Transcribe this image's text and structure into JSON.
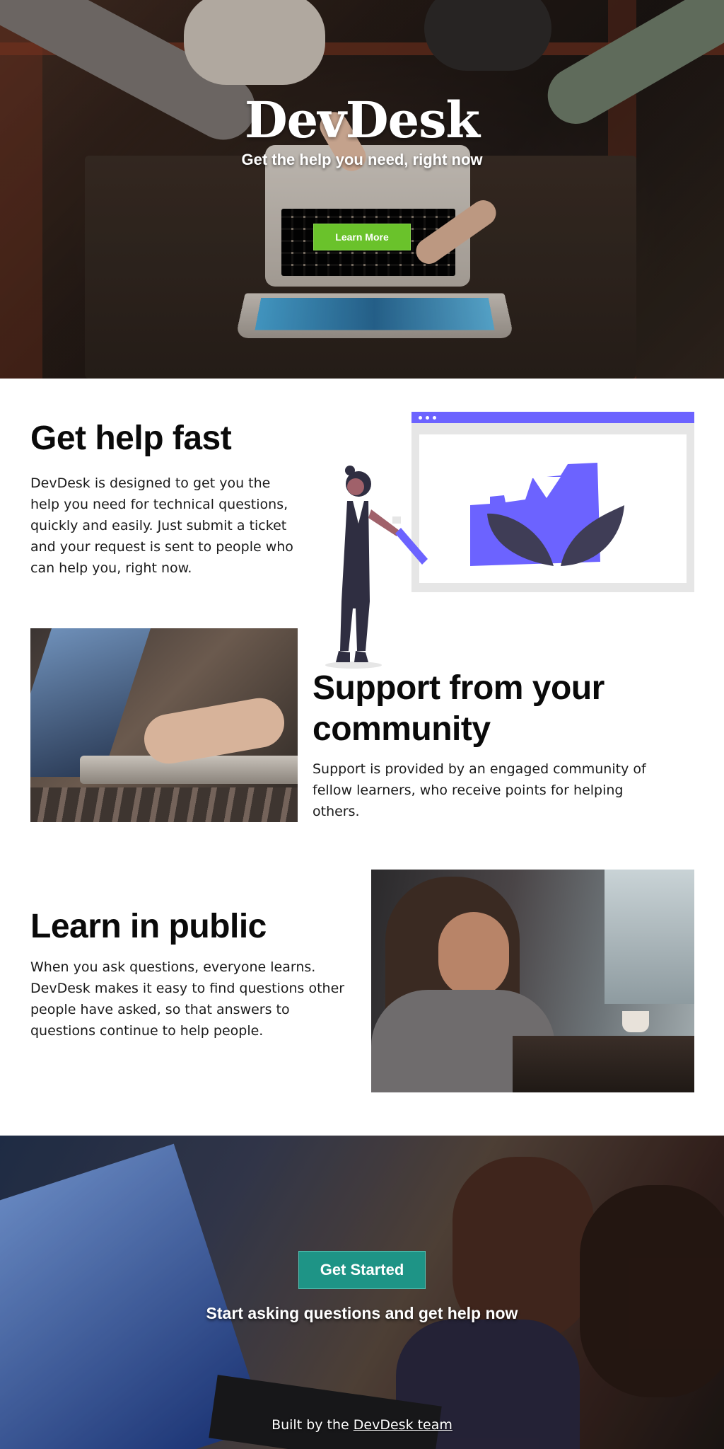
{
  "hero": {
    "title": "DevDesk",
    "subtitle": "Get the help you need, right now",
    "cta_label": "Learn More",
    "cta_color": "#6ac22b"
  },
  "sections": {
    "fast": {
      "heading": "Get help fast",
      "text": "DevDesk is designed to get you the help you need for technical questions, quickly and easily. Just submit a ticket and your request is sent to people who can help you, right now."
    },
    "community": {
      "heading": "Support from your community",
      "text": "Support is provided by an engaged community of fellow learners, who receive points for helping others."
    },
    "public": {
      "heading": "Learn in public",
      "text": "When you ask questions, everyone learns. DevDesk makes it easy to find questions other people have asked, so that answers to questions continue to help people."
    }
  },
  "illustration": {
    "accent_color": "#6c63ff",
    "dark_color": "#3f3d56"
  },
  "footer": {
    "cta_label": "Get Started",
    "cta_color": "#1e9486",
    "tagline": "Start asking questions and get help now",
    "credit_prefix": "Built by the ",
    "credit_link": "DevDesk team"
  }
}
